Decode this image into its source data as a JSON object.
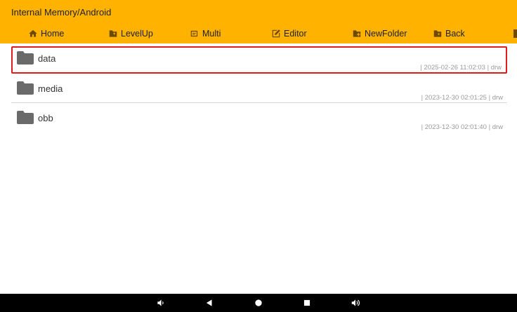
{
  "header": {
    "path": "Internal Memory/Android"
  },
  "toolbar": {
    "items": [
      {
        "label": "Home",
        "icon": "home-icon"
      },
      {
        "label": "LevelUp",
        "icon": "folder-up-icon"
      },
      {
        "label": "Multi",
        "icon": "multi-select-icon"
      },
      {
        "label": "Editor",
        "icon": "edit-icon"
      },
      {
        "label": "NewFolder",
        "icon": "new-folder-icon"
      },
      {
        "label": "Back",
        "icon": "folder-back-icon"
      }
    ]
  },
  "files": [
    {
      "name": "data",
      "meta": "| 2025-02-26 11:02:03 | drw",
      "selected": true
    },
    {
      "name": "media",
      "meta": "| 2023-12-30 02:01:25 | drw",
      "selected": false
    },
    {
      "name": "obb",
      "meta": "| 2023-12-30 02:01:40 | drw",
      "selected": false
    }
  ],
  "colors": {
    "toolbar_bg": "#ffb200",
    "selection_border": "#e01b1b",
    "folder_icon": "#6a6a6a",
    "navbar_bg": "#000000"
  },
  "navbar": {
    "icons": [
      "volume-down-icon",
      "back-icon",
      "home-circle-icon",
      "recents-icon",
      "volume-up-icon"
    ]
  }
}
